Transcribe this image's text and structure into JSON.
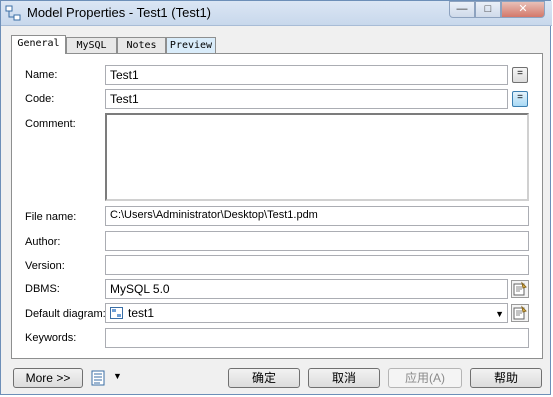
{
  "window": {
    "title": "Model Properties - Test1 (Test1)",
    "min_icon": "minimize-icon",
    "max_icon": "maximize-icon",
    "close_icon": "close-icon"
  },
  "tabs": [
    {
      "label": "General",
      "active": true
    },
    {
      "label": "MySQL",
      "active": false
    },
    {
      "label": "Notes",
      "active": false
    },
    {
      "label": "Preview",
      "active": false
    }
  ],
  "form": {
    "name_label": "Name:",
    "name_value": "Test1",
    "code_label": "Code:",
    "code_value": "Test1",
    "comment_label": "Comment:",
    "comment_value": "",
    "file_label": "File name:",
    "file_value": "C:\\Users\\Administrator\\Desktop\\Test1.pdm",
    "author_label": "Author:",
    "author_value": "",
    "version_label": "Version:",
    "version_value": "",
    "dbms_label": "DBMS:",
    "dbms_value": "MySQL 5.0",
    "diagram_label": "Default diagram:",
    "diagram_value": "test1",
    "keywords_label": "Keywords:",
    "keywords_value": "",
    "equal_btn": "="
  },
  "footer": {
    "more_label": "More >>",
    "ok_label": "确定",
    "cancel_label": "取消",
    "apply_label": "应用(A)",
    "help_label": "帮助"
  },
  "colors": {
    "accent": "#3c7fb1",
    "preview_tab": "#d9ecfa"
  }
}
